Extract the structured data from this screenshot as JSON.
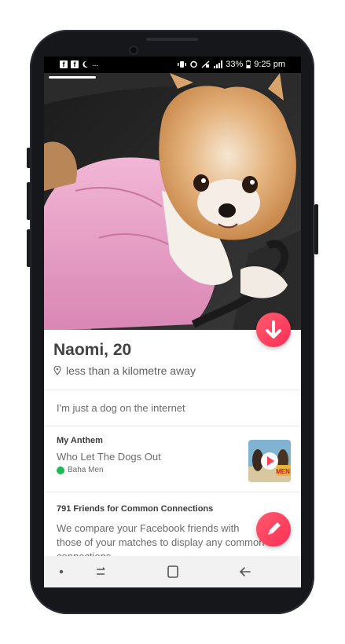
{
  "status_bar": {
    "left_icons": [
      "facebook-icon",
      "facebook-icon",
      "moon-icon"
    ],
    "overflow": "...",
    "battery_percent": "33%",
    "time": "9:25 pm"
  },
  "profile": {
    "name_age": "Naomi, 20",
    "distance": "less than a kilometre away",
    "bio": "I'm just a dog on the internet",
    "photo_count_shown": 1
  },
  "anthem": {
    "heading": "My Anthem",
    "song": "Who Let The Dogs Out",
    "artist": "Baha Men",
    "album_text": "MEN"
  },
  "friends": {
    "heading": "791 Friends for Common Connections",
    "text_line1": "We compare your Facebook friends with",
    "text_line2": "those of your matches to display any common",
    "text_line3": "connections."
  },
  "colors": {
    "accent": "#fd3f5c",
    "text_primary": "#424242",
    "text_secondary": "#6b6b6b",
    "spotify": "#1db954"
  },
  "icons": {
    "dislike": "arrow-down-icon",
    "edit": "pencil-icon",
    "location": "location-pin-icon",
    "play": "play-icon",
    "nav": [
      "dot-icon",
      "recents-icon",
      "home-icon",
      "back-icon"
    ]
  }
}
